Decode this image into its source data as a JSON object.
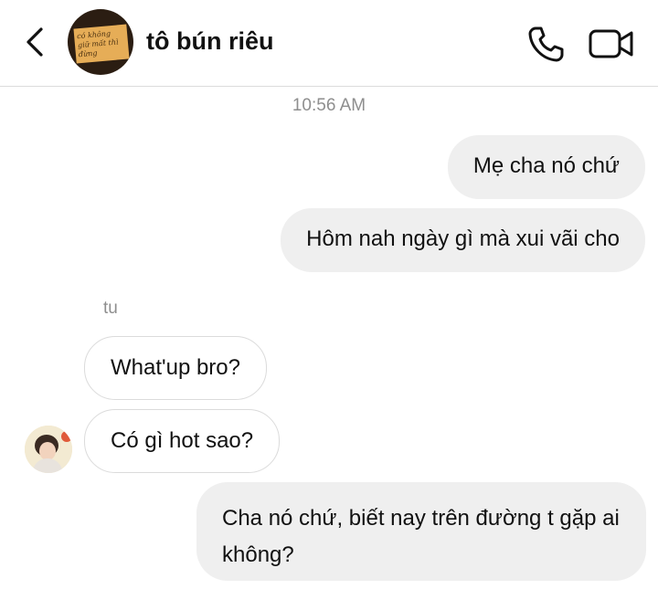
{
  "header": {
    "title": "tô bún riêu",
    "avatar_sign_text": "có không giữ mất thì đừng"
  },
  "icons": {
    "back": "chevron-left-icon",
    "call": "phone-icon",
    "video": "video-camera-icon"
  },
  "chat": {
    "timestamp": "10:56 AM",
    "messages": [
      {
        "direction": "outgoing",
        "text": "Mẹ cha nó chứ"
      },
      {
        "direction": "outgoing",
        "text": "Hôm nah ngày gì mà xui vãi cho"
      },
      {
        "direction": "incoming",
        "sender": "tu",
        "text": "What'up bro?"
      },
      {
        "direction": "incoming",
        "text": "Có gì hot sao?"
      },
      {
        "direction": "outgoing",
        "text": "Cha nó chứ, biết nay trên đường t gặp ai không?"
      }
    ]
  },
  "colors": {
    "outgoing_bubble": "#efefef",
    "incoming_border": "#dbdbdb",
    "meta_text": "#8e8e8e"
  }
}
